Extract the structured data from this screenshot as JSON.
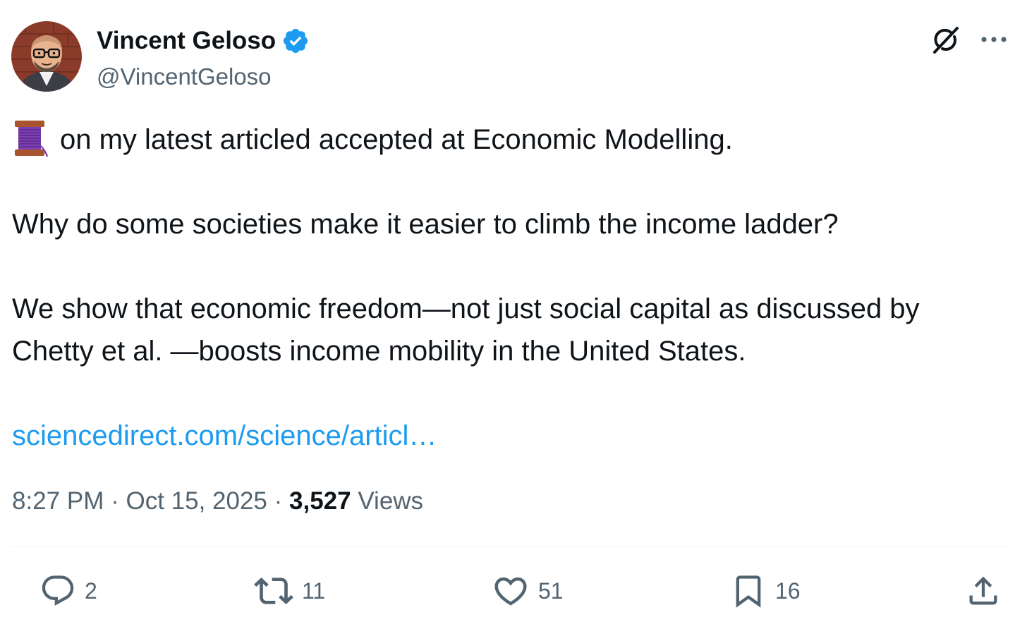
{
  "author": {
    "name": "Vincent Geloso",
    "handle": "@VincentGeloso",
    "verified": true,
    "avatar": "avatar-cartoon"
  },
  "header_icons": [
    "grok-icon",
    "more-icon"
  ],
  "tweet": {
    "lead_emoji": "thread-spool-emoji",
    "line1": "on my latest articled accepted at Economic Modelling.",
    "paragraph2": "Why do some societies make it easier to climb the income ladder?",
    "paragraph3_line1": "We show that economic freedom—not just social capital as discussed by",
    "paragraph3_line2": "Chetty et al. —boosts income mobility in the United States.",
    "link_text": "sciencedirect.com/science/articl…"
  },
  "meta": {
    "time": "8:27 PM",
    "separator": " · ",
    "date": "Oct 15, 2025",
    "views_count": "3,527",
    "views_label": "Views"
  },
  "actions": {
    "reply_count": "2",
    "retweet_count": "11",
    "like_count": "51",
    "bookmark_count": "16"
  },
  "colors": {
    "text": "#0f1419",
    "secondary": "#536471",
    "link": "#1d9bf0",
    "verified": "#1d9bf0",
    "divider": "#eff3f4"
  }
}
